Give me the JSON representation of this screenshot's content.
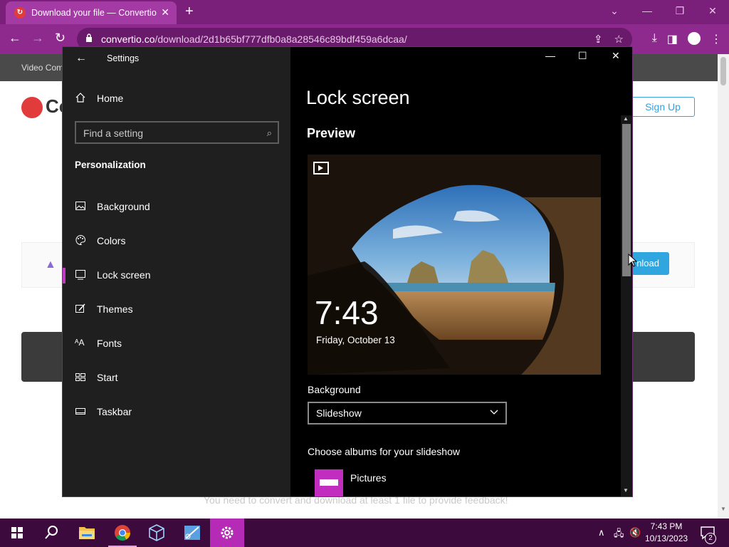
{
  "browser": {
    "tab_title": "Download your file — Convertio",
    "url_host": "convertio.co",
    "url_path": "/download/2d1b65bf777dfb0a8a28546c89bdf459a6dcaa/"
  },
  "website": {
    "nav_text": "Video Com",
    "logo_text": "Co",
    "signup_label": "Sign Up",
    "download_label": "nload",
    "feedback_text": "You need to convert and download at least 1 file to provide feedback!"
  },
  "settings": {
    "app_title": "Settings",
    "home_label": "Home",
    "search_placeholder": "Find a setting",
    "section_heading": "Personalization",
    "nav_items": [
      {
        "label": "Background",
        "icon": "picture-icon"
      },
      {
        "label": "Colors",
        "icon": "palette-icon"
      },
      {
        "label": "Lock screen",
        "icon": "lock-screen-icon"
      },
      {
        "label": "Themes",
        "icon": "themes-icon"
      },
      {
        "label": "Fonts",
        "icon": "fonts-icon"
      },
      {
        "label": "Start",
        "icon": "start-icon"
      },
      {
        "label": "Taskbar",
        "icon": "taskbar-icon"
      }
    ],
    "page_title": "Lock screen",
    "preview_label": "Preview",
    "preview_time": "7:43",
    "preview_date": "Friday, October 13",
    "background_label": "Background",
    "background_value": "Slideshow",
    "albums_label": "Choose albums for your slideshow",
    "album_name": "Pictures",
    "accent_color": "#c239c2"
  },
  "taskbar": {
    "time": "7:43 PM",
    "date": "10/13/2023",
    "notification_count": "2"
  }
}
